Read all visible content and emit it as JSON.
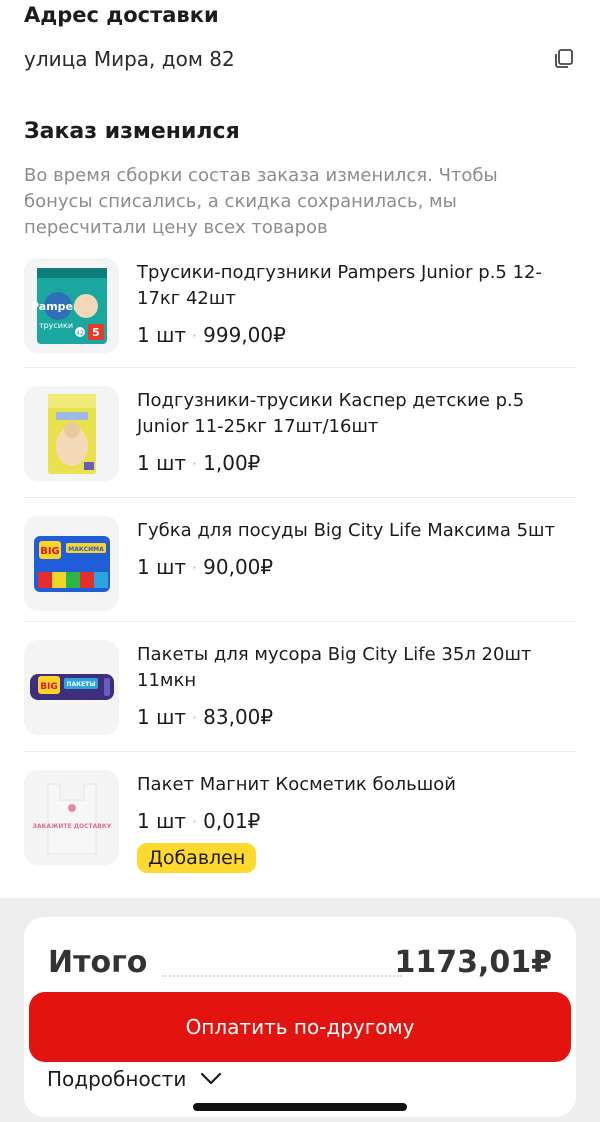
{
  "address": {
    "title": "Адрес доставки",
    "value": "улица Мира, дом 82",
    "copy_icon": "copy-icon"
  },
  "order_changed": {
    "title": "Заказ изменился",
    "description": "Во время сборки состав заказа изменился. Чтобы бонусы списались, а скидка сохранилась, мы пересчитали цену всех товаров"
  },
  "items": [
    {
      "name": "Трусики-подгузники Pampers Junior р.5 12-17кг 42шт",
      "qty": "1 шт",
      "price": "999,00₽",
      "badge": ""
    },
    {
      "name": "Подгузники-трусики Каспер детские р.5 Junior 11-25кг 17шт/16шт",
      "qty": "1 шт",
      "price": "1,00₽",
      "badge": ""
    },
    {
      "name": "Губка для посуды Big City Life Максима 5шт",
      "qty": "1 шт",
      "price": "90,00₽",
      "badge": ""
    },
    {
      "name": "Пакеты для мусора Big City Life 35л 20шт 11мкн",
      "qty": "1 шт",
      "price": "83,00₽",
      "badge": ""
    },
    {
      "name": "Пакет Магнит Косметик большой",
      "qty": "1 шт",
      "price": "0,01₽",
      "badge": "Добавлен"
    }
  ],
  "item_separator": "·",
  "product_images": {
    "pampers_brand": "Pampers",
    "pampers_sub": "трусики",
    "pampers_size": "5",
    "pampers_count": "42",
    "bigcity_logo": "BIG",
    "sponge_label": "МАКСИМА",
    "bags_label": "ПАКЕТЫ",
    "magnit_bag_text": "ЗАКАЖИТЕ ДОСТАВКУ"
  },
  "total": {
    "label": "Итого",
    "sum": "1173,01₽",
    "pay_button": "Оплатить по-другому",
    "details": "Подробности"
  },
  "colors": {
    "accent_red": "#e3140f",
    "badge_yellow": "#ffd92e",
    "muted_text": "#8c8c8c"
  }
}
